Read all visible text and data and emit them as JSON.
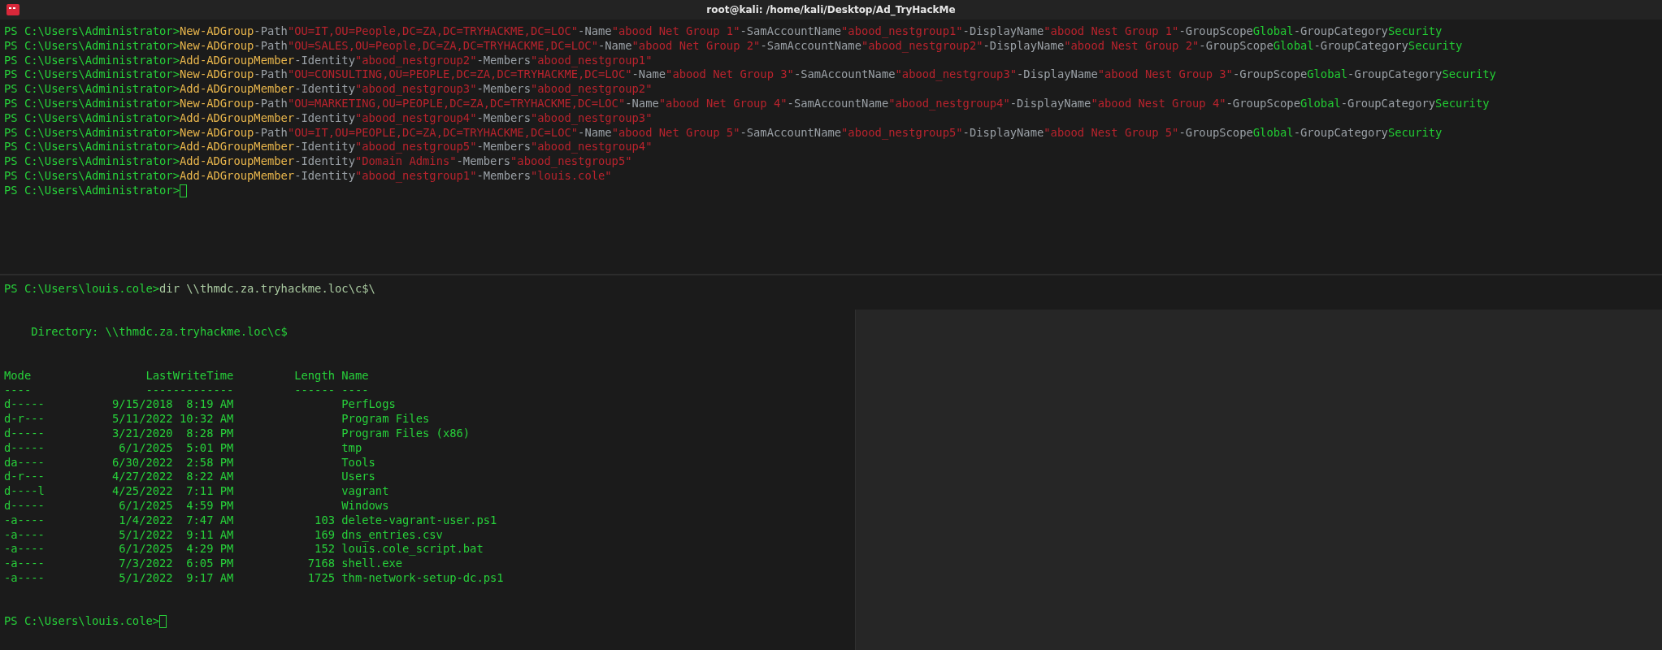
{
  "window": {
    "title": "root@kali: /home/kali/Desktop/Ad_TryHackMe"
  },
  "top_pane": {
    "lines": [
      {
        "prompt": "PS C:\\Users\\Administrator>",
        "tokens": [
          {
            "kind": "cmdlet",
            "text": "New-ADGroup"
          },
          {
            "kind": "param",
            "text": "-Path"
          },
          {
            "kind": "string",
            "text": "\"OU=IT,OU=People,DC=ZA,DC=TRYHACKME,DC=LOC\""
          },
          {
            "kind": "param",
            "text": "-Name"
          },
          {
            "kind": "string",
            "text": "\"abood Net Group 1\""
          },
          {
            "kind": "param",
            "text": "-SamAccountName"
          },
          {
            "kind": "string",
            "text": "\"abood_nestgroup1\""
          },
          {
            "kind": "param",
            "text": "-DisplayName"
          },
          {
            "kind": "string",
            "text": "\"abood Nest Group 1\""
          },
          {
            "kind": "param",
            "text": "-GroupScope"
          },
          {
            "kind": "value",
            "text": "Global"
          },
          {
            "kind": "param",
            "text": "-GroupCategory"
          },
          {
            "kind": "value",
            "text": "Security"
          }
        ]
      },
      {
        "prompt": "PS C:\\Users\\Administrator>",
        "tokens": [
          {
            "kind": "cmdlet",
            "text": "New-ADGroup"
          },
          {
            "kind": "param",
            "text": "-Path"
          },
          {
            "kind": "string",
            "text": "\"OU=SALES,OU=People,DC=ZA,DC=TRYHACKME,DC=LOC\""
          },
          {
            "kind": "param",
            "text": "-Name"
          },
          {
            "kind": "string",
            "text": "\"abood Net Group 2\""
          },
          {
            "kind": "param",
            "text": "-SamAccountName"
          },
          {
            "kind": "string",
            "text": "\"abood_nestgroup2\""
          },
          {
            "kind": "param",
            "text": "-DisplayName"
          },
          {
            "kind": "string",
            "text": "\"abood Nest Group 2\""
          },
          {
            "kind": "param",
            "text": "-GroupScope"
          },
          {
            "kind": "value",
            "text": "Global"
          },
          {
            "kind": "param",
            "text": "-GroupCategory"
          },
          {
            "kind": "value",
            "text": "Security"
          }
        ]
      },
      {
        "prompt": "PS C:\\Users\\Administrator>",
        "tokens": [
          {
            "kind": "cmdlet",
            "text": "Add-ADGroupMember"
          },
          {
            "kind": "param",
            "text": "-Identity"
          },
          {
            "kind": "string",
            "text": "\"abood_nestgroup2\""
          },
          {
            "kind": "param",
            "text": "-Members"
          },
          {
            "kind": "string",
            "text": "\"abood_nestgroup1\""
          }
        ]
      },
      {
        "prompt": "PS C:\\Users\\Administrator>",
        "tokens": [
          {
            "kind": "cmdlet",
            "text": "New-ADGroup"
          },
          {
            "kind": "param",
            "text": "-Path"
          },
          {
            "kind": "string",
            "text": "\"OU=CONSULTING,OU=PEOPLE,DC=ZA,DC=TRYHACKME,DC=LOC\""
          },
          {
            "kind": "param",
            "text": "-Name"
          },
          {
            "kind": "string",
            "text": "\"abood Net Group 3\""
          },
          {
            "kind": "param",
            "text": "-SamAccountName"
          },
          {
            "kind": "string",
            "text": "\"abood_nestgroup3\""
          },
          {
            "kind": "param",
            "text": "-DisplayName"
          },
          {
            "kind": "string",
            "text": "\"abood Nest Group 3\""
          },
          {
            "kind": "param",
            "text": "-GroupScope"
          },
          {
            "kind": "value",
            "text": "Global"
          },
          {
            "kind": "param",
            "text": "-GroupCategory"
          },
          {
            "kind": "value",
            "text": "Security"
          }
        ]
      },
      {
        "prompt": "PS C:\\Users\\Administrator>",
        "tokens": [
          {
            "kind": "cmdlet",
            "text": "Add-ADGroupMember"
          },
          {
            "kind": "param",
            "text": "-Identity"
          },
          {
            "kind": "string",
            "text": "\"abood_nestgroup3\""
          },
          {
            "kind": "param",
            "text": "-Members"
          },
          {
            "kind": "string",
            "text": "\"abood_nestgroup2\""
          }
        ]
      },
      {
        "prompt": "PS C:\\Users\\Administrator>",
        "tokens": [
          {
            "kind": "cmdlet",
            "text": "New-ADGroup"
          },
          {
            "kind": "param",
            "text": "-Path"
          },
          {
            "kind": "string",
            "text": "\"OU=MARKETING,OU=PEOPLE,DC=ZA,DC=TRYHACKME,DC=LOC\""
          },
          {
            "kind": "param",
            "text": "-Name"
          },
          {
            "kind": "string",
            "text": "\"abood Net Group 4\""
          },
          {
            "kind": "param",
            "text": "-SamAccountName"
          },
          {
            "kind": "string",
            "text": "\"abood_nestgroup4\""
          },
          {
            "kind": "param",
            "text": "-DisplayName"
          },
          {
            "kind": "string",
            "text": "\"abood Nest Group 4\""
          },
          {
            "kind": "param",
            "text": "-GroupScope"
          },
          {
            "kind": "value",
            "text": "Global"
          },
          {
            "kind": "param",
            "text": "-GroupCategory"
          },
          {
            "kind": "value",
            "text": "Security"
          }
        ]
      },
      {
        "prompt": "PS C:\\Users\\Administrator>",
        "tokens": [
          {
            "kind": "cmdlet",
            "text": "Add-ADGroupMember"
          },
          {
            "kind": "param",
            "text": "-Identity"
          },
          {
            "kind": "string",
            "text": "\"abood_nestgroup4\""
          },
          {
            "kind": "param",
            "text": "-Members"
          },
          {
            "kind": "string",
            "text": "\"abood_nestgroup3\""
          }
        ]
      },
      {
        "prompt": "PS C:\\Users\\Administrator>",
        "tokens": [
          {
            "kind": "cmdlet",
            "text": "New-ADGroup"
          },
          {
            "kind": "param",
            "text": "-Path"
          },
          {
            "kind": "string",
            "text": "\"OU=IT,OU=PEOPLE,DC=ZA,DC=TRYHACKME,DC=LOC\""
          },
          {
            "kind": "param",
            "text": "-Name"
          },
          {
            "kind": "string",
            "text": "\"abood Net Group 5\""
          },
          {
            "kind": "param",
            "text": "-SamAccountName"
          },
          {
            "kind": "string",
            "text": "\"abood_nestgroup5\""
          },
          {
            "kind": "param",
            "text": "-DisplayName"
          },
          {
            "kind": "string",
            "text": "\"abood Nest Group 5\""
          },
          {
            "kind": "param",
            "text": "-GroupScope"
          },
          {
            "kind": "value",
            "text": "Global"
          },
          {
            "kind": "param",
            "text": "-GroupCategory"
          },
          {
            "kind": "value",
            "text": "Security"
          }
        ]
      },
      {
        "prompt": "PS C:\\Users\\Administrator>",
        "tokens": [
          {
            "kind": "cmdlet",
            "text": "Add-ADGroupMember"
          },
          {
            "kind": "param",
            "text": "-Identity"
          },
          {
            "kind": "string",
            "text": "\"abood_nestgroup5\""
          },
          {
            "kind": "param",
            "text": "-Members"
          },
          {
            "kind": "string",
            "text": "\"abood_nestgroup4\""
          }
        ]
      },
      {
        "prompt": "PS C:\\Users\\Administrator>",
        "tokens": [
          {
            "kind": "cmdlet",
            "text": "Add-ADGroupMember"
          },
          {
            "kind": "param",
            "text": "-Identity"
          },
          {
            "kind": "string",
            "text": "\"Domain Admins\""
          },
          {
            "kind": "param",
            "text": "-Members"
          },
          {
            "kind": "string",
            "text": "\"abood_nestgroup5\""
          }
        ]
      },
      {
        "prompt": "PS C:\\Users\\Administrator>",
        "tokens": [
          {
            "kind": "cmdlet",
            "text": "Add-ADGroupMember"
          },
          {
            "kind": "param",
            "text": "-Identity"
          },
          {
            "kind": "string",
            "text": "\"abood_nestgroup1\""
          },
          {
            "kind": "param",
            "text": "-Members"
          },
          {
            "kind": "string",
            "text": "\"louis.cole\""
          }
        ]
      },
      {
        "prompt": "PS C:\\Users\\Administrator>"
      }
    ]
  },
  "bottom_pane": {
    "command": {
      "prompt": "PS C:\\Users\\louis.cole>",
      "text": "dir \\\\thmdc.za.tryhackme.loc\\c$\\"
    },
    "directory": "Directory: \\\\thmdc.za.tryhackme.loc\\c$",
    "columns": [
      {
        "label": "Mode",
        "rule": "----"
      },
      {
        "label": "LastWriteTime",
        "rule": "-------------"
      },
      {
        "label": "Length",
        "rule": "------"
      },
      {
        "label": "Name",
        "rule": "----"
      }
    ],
    "rows": [
      {
        "mode": "d-----",
        "date": "9/15/2018",
        "time": "8:19 AM",
        "name": "PerfLogs"
      },
      {
        "mode": "d-r---",
        "date": "5/11/2022",
        "time": "10:32 AM",
        "name": "Program Files"
      },
      {
        "mode": "d-----",
        "date": "3/21/2020",
        "time": "8:28 PM",
        "name": "Program Files (x86)"
      },
      {
        "mode": "d-----",
        "date": "6/1/2025",
        "time": "5:01 PM",
        "name": "tmp"
      },
      {
        "mode": "da----",
        "date": "6/30/2022",
        "time": "2:58 PM",
        "name": "Tools"
      },
      {
        "mode": "d-r---",
        "date": "4/27/2022",
        "time": "8:22 AM",
        "name": "Users"
      },
      {
        "mode": "d----l",
        "date": "4/25/2022",
        "time": "7:11 PM",
        "name": "vagrant"
      },
      {
        "mode": "d-----",
        "date": "6/1/2025",
        "time": "4:59 PM",
        "name": "Windows"
      },
      {
        "mode": "-a----",
        "date": "1/4/2022",
        "time": "7:47 AM",
        "length": "103",
        "name": "delete-vagrant-user.ps1"
      },
      {
        "mode": "-a----",
        "date": "5/1/2022",
        "time": "9:11 AM",
        "length": "169",
        "name": "dns_entries.csv"
      },
      {
        "mode": "-a----",
        "date": "6/1/2025",
        "time": "4:29 PM",
        "length": "152",
        "name": "louis.cole_script.bat"
      },
      {
        "mode": "-a----",
        "date": "7/3/2022",
        "time": "6:05 PM",
        "length": "7168",
        "name": "shell.exe"
      },
      {
        "mode": "-a----",
        "date": "5/1/2022",
        "time": "9:17 AM",
        "length": "1725",
        "name": "thm-network-setup-dc.ps1"
      }
    ],
    "final_prompt": "PS C:\\Users\\louis.cole>"
  }
}
